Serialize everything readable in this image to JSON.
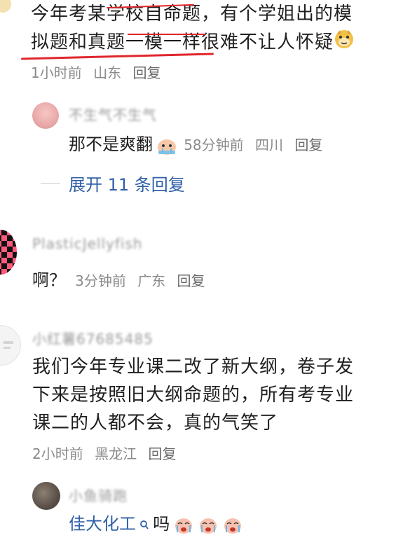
{
  "comments": [
    {
      "text_line1": "今年考某学校自命题，有个学姐出的模",
      "text_line2": "拟题和真题一模一样很难不让人怀疑",
      "emoji": "doge-icon",
      "time": "1小时前",
      "location": "山东",
      "reply_label": "回复",
      "replies": [
        {
          "username": "不生气不生气",
          "text": "那不是爽翻",
          "time": "58分钟前",
          "location": "四川",
          "reply_label": "回复"
        }
      ],
      "expand_label": "展开 11 条回复"
    },
    {
      "username": "PlasticJellyfish",
      "text": "啊？",
      "time": "3分钟前",
      "location": "广东",
      "reply_label": "回复"
    },
    {
      "username": "小红薯67685485",
      "text_line1": "我们今年专业课二改了新大纲，卷子发",
      "text_line2": "下来是按照旧大纲命题的，所有考专业",
      "text_line3": "课二的人都不会，真的气笑了",
      "time": "2小时前",
      "location": "黑龙江",
      "reply_label": "回复",
      "replies": [
        {
          "username": "小鱼骑跑",
          "text": "佳大化工",
          "search_icon": "search-icon",
          "suffix": "吗"
        }
      ]
    }
  ],
  "colors": {
    "annotation_red": "#e0262c",
    "link_blue": "#2f5fa8",
    "meta_gray": "#8a8a8a"
  }
}
